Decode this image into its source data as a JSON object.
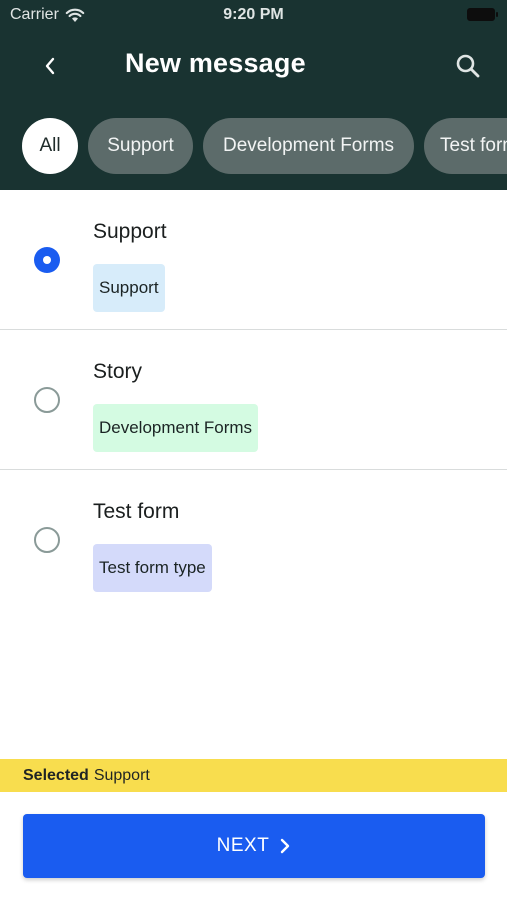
{
  "status_bar": {
    "carrier": "Carrier",
    "time": "9:20 PM"
  },
  "header": {
    "title": "New message",
    "back_icon": "chevron-left-icon",
    "search_icon": "search-icon"
  },
  "filters": [
    {
      "label": "All",
      "active": true
    },
    {
      "label": "Support",
      "active": false
    },
    {
      "label": "Development Forms",
      "active": false
    },
    {
      "label": "Test form",
      "active": false
    }
  ],
  "forms": [
    {
      "title": "Support",
      "tag": "Support",
      "tag_color": "#d7ecfa",
      "selected": true
    },
    {
      "title": "Story",
      "tag": "Development Forms",
      "tag_color": "#d4fbe2",
      "selected": false
    },
    {
      "title": "Test form",
      "tag": "Test form type",
      "tag_color": "#d4dafa",
      "selected": false
    }
  ],
  "selection": {
    "label": "Selected",
    "value": "Support"
  },
  "footer": {
    "next_label": "NEXT"
  },
  "colors": {
    "header_bg": "#193331",
    "accent": "#1a5cf0",
    "selected_bar": "#f8dd4e"
  }
}
